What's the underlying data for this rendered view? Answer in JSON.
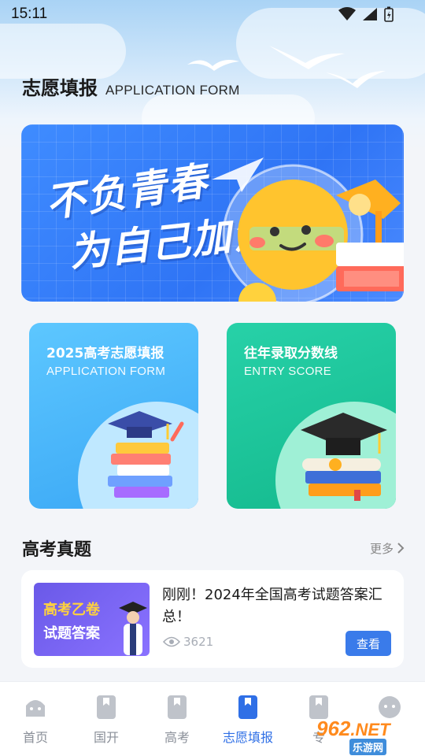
{
  "status_bar": {
    "time": "15:11"
  },
  "header": {
    "title_cn": "志愿填报",
    "title_en": "APPLICATION FORM"
  },
  "banner": {
    "line1": "不负青春",
    "line2": "为自己加油"
  },
  "cards": [
    {
      "title": "2025高考志愿填报",
      "subtitle": "APPLICATION FORM"
    },
    {
      "title": "往年录取分数线",
      "subtitle": "ENTRY SCORE"
    }
  ],
  "exam_section": {
    "title": "高考真题",
    "more_label": "更多"
  },
  "news": {
    "thumb_line1": "高考乙卷",
    "thumb_line2": "试题答案",
    "title": "刚刚！2024年全国高考试题答案汇总！",
    "views": "3621",
    "button_label": "查看"
  },
  "bottom_nav": {
    "items": [
      {
        "label": "首页",
        "icon": "home-face-icon"
      },
      {
        "label": "国开",
        "icon": "bookmark-icon"
      },
      {
        "label": "高考",
        "icon": "bookmark-icon"
      },
      {
        "label": "志愿填报",
        "icon": "bookmark-icon",
        "active": true
      },
      {
        "label": "专",
        "icon": "bookmark-icon"
      },
      {
        "label": "",
        "icon": "chat-face-icon"
      }
    ]
  },
  "watermark": {
    "number": "962",
    "domain": ".NET",
    "sub": "乐游网"
  },
  "colors": {
    "accent": "#2f6fe6",
    "card_blue": "#3aa7f5",
    "card_green": "#14b98d"
  }
}
